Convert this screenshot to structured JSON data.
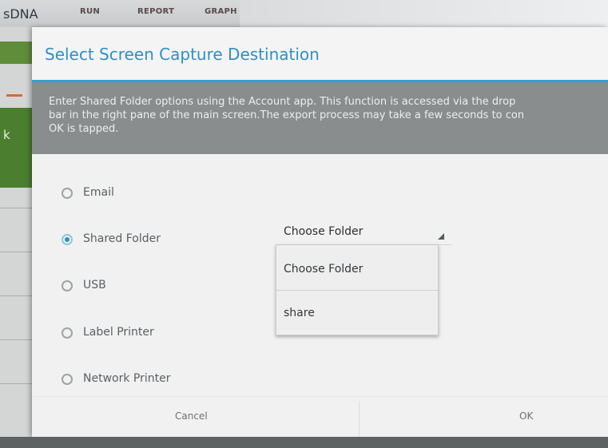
{
  "app": {
    "name": "sDNA",
    "tabs": [
      "RUN",
      "REPORT",
      "GRAPH"
    ],
    "side_text": "k"
  },
  "dialog": {
    "title": "Select Screen Capture Destination",
    "info_lines": [
      "Enter Shared Folder options using the Account app. This function is accessed via the drop",
      "bar in the right pane of the main screen.The export process may take a few seconds to con",
      "OK is tapped."
    ],
    "options": [
      {
        "label": "Email",
        "selected": false
      },
      {
        "label": "Shared Folder",
        "selected": true
      },
      {
        "label": "USB",
        "selected": false
      },
      {
        "label": "Label Printer",
        "selected": false
      },
      {
        "label": "Network Printer",
        "selected": false
      }
    ],
    "folder_select": {
      "value": "Choose Folder",
      "options": [
        "Choose Folder",
        "share"
      ]
    },
    "buttons": {
      "cancel": "Cancel",
      "ok": "OK"
    }
  },
  "colors": {
    "accent": "#2f8fc6",
    "info_band": "#8a8d8e",
    "app_green": "#4b7f2f"
  }
}
